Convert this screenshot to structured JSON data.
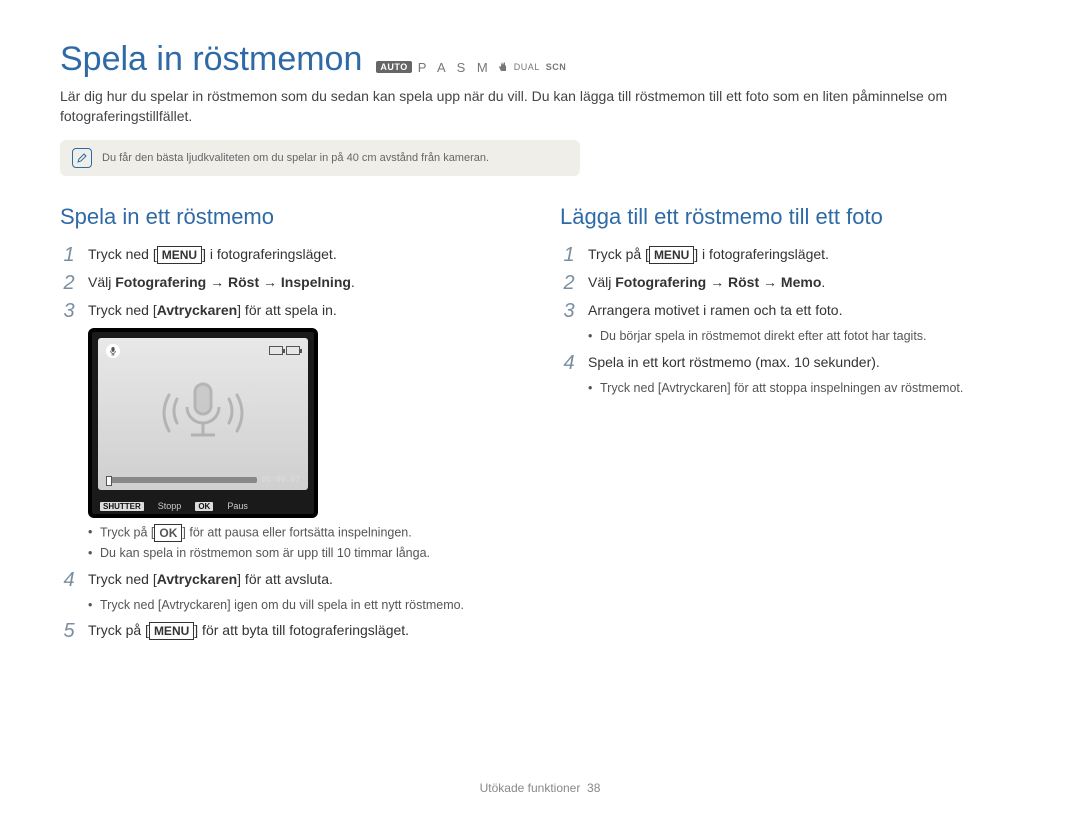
{
  "title": "Spela in röstmemon",
  "mode_badge_auto": "AUTO",
  "modes_main": "P A S M",
  "modes_dual": "DUAL",
  "modes_scn": "SCN",
  "intro": "Lär dig hur du spelar in röstmemon som du sedan kan spela upp när du vill. Du kan lägga till röstmemon till ett foto som en liten påminnelse om fotograferingstillfället.",
  "note": "Du får den bästa ljudkvaliteten om du spelar in på 40 cm avstånd från kameran.",
  "left": {
    "heading": "Spela in ett röstmemo",
    "steps": {
      "s1_num": "1",
      "s1_pre": "Tryck ned [",
      "s1_btn": "MENU",
      "s1_post": "] i fotograferingsläget.",
      "s2_num": "2",
      "s2_pre": "Välj ",
      "s2_b1": "Fotografering",
      "s2_arrow1": " → ",
      "s2_b2": "Röst",
      "s2_arrow2": " → ",
      "s2_b3": "Inspelning",
      "s2_post": ".",
      "s3_num": "3",
      "s3_pre": "Tryck ned [",
      "s3_b": "Avtryckaren",
      "s3_post": "] för att spela in.",
      "fig": {
        "time": "00:00:07",
        "foot_shutter_lbl": "SHUTTER",
        "foot_shutter_txt": "Stopp",
        "foot_ok_lbl": "OK",
        "foot_ok_txt": "Paus"
      },
      "s3_bul1_pre": "Tryck på [",
      "s3_bul1_btn": "OK",
      "s3_bul1_post": "] för att pausa eller fortsätta inspelningen.",
      "s3_bul2": "Du kan spela in röstmemon som är upp till 10 timmar långa.",
      "s4_num": "4",
      "s4_pre": "Tryck ned [",
      "s4_b": "Avtryckaren",
      "s4_post": "] för att avsluta.",
      "s4_bul1_pre": "Tryck ned [",
      "s4_bul1_b": "Avtryckaren",
      "s4_bul1_post": "] igen om du vill spela in ett nytt röstmemo.",
      "s5_num": "5",
      "s5_pre": "Tryck på [",
      "s5_btn": "MENU",
      "s5_post": "] för att byta till fotograferingsläget."
    }
  },
  "right": {
    "heading": "Lägga till ett röstmemo till ett foto",
    "steps": {
      "s1_num": "1",
      "s1_pre": "Tryck på [",
      "s1_btn": "MENU",
      "s1_post": "] i fotograferingsläget.",
      "s2_num": "2",
      "s2_pre": "Välj ",
      "s2_b1": "Fotografering",
      "s2_arrow1": " → ",
      "s2_b2": "Röst",
      "s2_arrow2": " → ",
      "s2_b3": "Memo",
      "s2_post": ".",
      "s3_num": "3",
      "s3_text": "Arrangera motivet i ramen och ta ett foto.",
      "s3_bul1": "Du börjar spela in röstmemot direkt efter att fotot har tagits.",
      "s4_num": "4",
      "s4_text": "Spela in ett kort röstmemo (max. 10 sekunder).",
      "s4_bul1_pre": "Tryck ned [",
      "s4_bul1_b": "Avtryckaren",
      "s4_bul1_post": "] för att stoppa inspelningen av röstmemot."
    }
  },
  "footer_section": "Utökade funktioner",
  "footer_page": "38"
}
